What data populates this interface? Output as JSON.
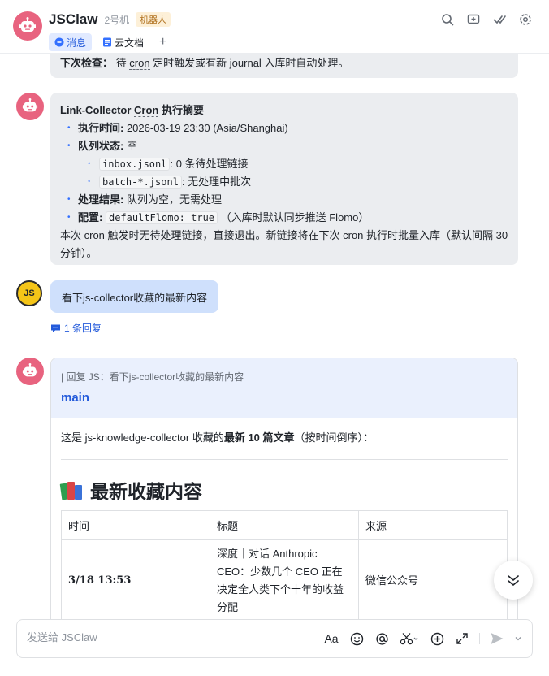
{
  "header": {
    "app_title": "JSClaw",
    "subtitle": "2号机",
    "badge": "机器人",
    "tabs": [
      {
        "label": "消息",
        "active": true
      },
      {
        "label": "云文档",
        "active": false
      }
    ],
    "add_tab": "+"
  },
  "messages": {
    "top_bubble": {
      "label": "下次检查：",
      "text_pre": "待 ",
      "cron": "cron",
      "text_post": " 定时触发或有新 journal 入库时自动处理。"
    },
    "cron_summary": {
      "title_pre": "Link-Collector ",
      "title_cron": "Cron",
      "title_post": " 执行摘要",
      "exec_time_label": "执行时间:",
      "exec_time_value": " 2026-03-19 23:30 (Asia/Shanghai)",
      "queue_label": "队列状态:",
      "queue_value": " 空",
      "inbox_code": "inbox.jsonl",
      "inbox_text": ": 0 条待处理链接",
      "batch_code": "batch-*.jsonl",
      "batch_text": ": 无处理中批次",
      "result_label": "处理结果:",
      "result_value": " 队列为空，无需处理",
      "config_label": "配置:",
      "config_code": "defaultFlomo: true",
      "config_note": " （入库时默认同步推送 Flomo）",
      "footer": "本次 cron 触发时无待处理链接，直接退出。新链接将在下次 cron 执行时批量入库（默认间隔 30 分钟）。"
    },
    "user": {
      "avatar_text": "JS",
      "text": "看下js-collector收藏的最新内容",
      "replies": "1 条回复"
    },
    "reply_card": {
      "quote": "| 回复 JS：看下js-collector收藏的最新内容",
      "title": "main",
      "intro_pre": "这是 js-knowledge-collector 收藏的",
      "intro_bold": "最新 10 篇文章",
      "intro_post": "（按时间倒序）：",
      "heading": "最新收藏内容",
      "table": {
        "headers": [
          "时间",
          "标题",
          "来源"
        ],
        "rows": [
          {
            "time": "3/18 13:53",
            "title": "深度｜对话 Anthropic CEO：少数几个 CEO 正在决定全人类下个十年的收益分配",
            "source": "微信公众号"
          }
        ]
      }
    }
  },
  "composer": {
    "placeholder": "发送给 JSClaw",
    "font_tool": "Aa"
  },
  "colors": {
    "accent": "#245bdb",
    "bot_avatar": "#e8637f",
    "user_bubble": "#cfe0fc",
    "bot_bubble": "#ebedf0"
  }
}
